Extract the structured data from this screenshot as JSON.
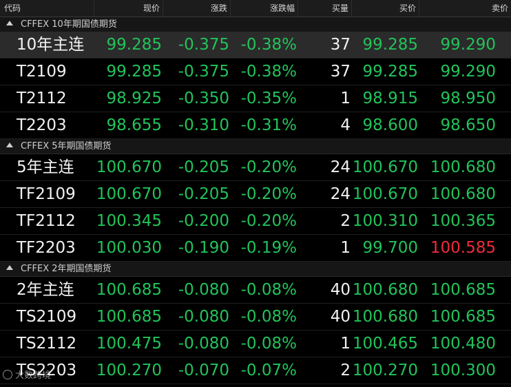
{
  "header": {
    "code": "代码",
    "price": "现价",
    "change": "涨跌",
    "change_pct": "涨跌幅",
    "buy_qty": "买量",
    "bid": "买价",
    "ask": "卖价"
  },
  "groups": [
    {
      "name": "CFFEX 10年期国债期货",
      "rows": [
        {
          "code": "10年主连",
          "price": "99.285",
          "change": "-0.375",
          "pct": "-0.38%",
          "qty": "37",
          "bid": "99.285",
          "ask": "99.290"
        },
        {
          "code": "T2109",
          "price": "99.285",
          "change": "-0.375",
          "pct": "-0.38%",
          "qty": "37",
          "bid": "99.285",
          "ask": "99.290"
        },
        {
          "code": "T2112",
          "price": "98.925",
          "change": "-0.350",
          "pct": "-0.35%",
          "qty": "1",
          "bid": "98.915",
          "ask": "98.950"
        },
        {
          "code": "T2203",
          "price": "98.655",
          "change": "-0.310",
          "pct": "-0.31%",
          "qty": "4",
          "bid": "98.600",
          "ask": "98.650"
        }
      ]
    },
    {
      "name": "CFFEX 5年期国债期货",
      "rows": [
        {
          "code": "5年主连",
          "price": "100.670",
          "change": "-0.205",
          "pct": "-0.20%",
          "qty": "24",
          "bid": "100.670",
          "ask": "100.680"
        },
        {
          "code": "TF2109",
          "price": "100.670",
          "change": "-0.205",
          "pct": "-0.20%",
          "qty": "24",
          "bid": "100.670",
          "ask": "100.680"
        },
        {
          "code": "TF2112",
          "price": "100.345",
          "change": "-0.200",
          "pct": "-0.20%",
          "qty": "2",
          "bid": "100.310",
          "ask": "100.365"
        },
        {
          "code": "TF2203",
          "price": "100.030",
          "change": "-0.190",
          "pct": "-0.19%",
          "qty": "1",
          "bid": "99.700",
          "ask": "100.585"
        }
      ]
    },
    {
      "name": "CFFEX 2年期国债期货",
      "rows": [
        {
          "code": "2年主连",
          "price": "100.685",
          "change": "-0.080",
          "pct": "-0.08%",
          "qty": "40",
          "bid": "100.680",
          "ask": "100.685"
        },
        {
          "code": "TS2109",
          "price": "100.685",
          "change": "-0.080",
          "pct": "-0.08%",
          "qty": "40",
          "bid": "100.680",
          "ask": "100.685"
        },
        {
          "code": "TS2112",
          "price": "100.475",
          "change": "-0.080",
          "pct": "-0.08%",
          "qty": "1",
          "bid": "100.465",
          "ask": "100.480"
        },
        {
          "code": "TS2203",
          "price": "100.270",
          "change": "-0.070",
          "pct": "-0.07%",
          "qty": "2",
          "bid": "100.270",
          "ask": "100.300"
        }
      ]
    }
  ],
  "watermark": "大数跨境",
  "colors": {
    "down": "#22c35a",
    "up": "#ee2b3b",
    "neutral": "#f2f2f2",
    "selected_row": "#2b2b2b"
  }
}
